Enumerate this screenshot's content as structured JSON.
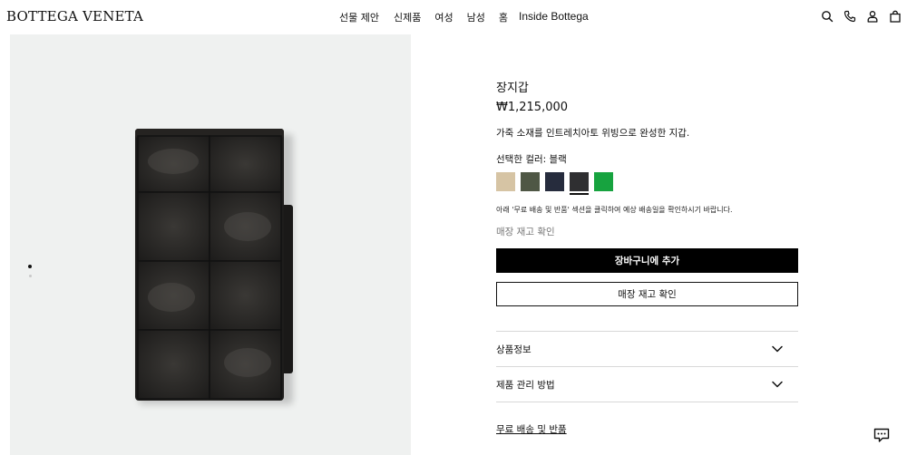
{
  "brand": {
    "logo": "BOTTEGA VENETA"
  },
  "nav": {
    "items": [
      {
        "label": "선물 제안"
      },
      {
        "label": "신제품"
      },
      {
        "label": "여성"
      },
      {
        "label": "남성"
      },
      {
        "label": "홈"
      },
      {
        "label": "Inside Bottega"
      }
    ]
  },
  "header_icons": [
    "search-icon",
    "phone-icon",
    "account-icon",
    "shopping-bag-icon"
  ],
  "gallery": {
    "image": "wallet-image",
    "slide_indicator": {
      "total": 2,
      "active": 1
    }
  },
  "product": {
    "title": "장지갑",
    "price": "₩1,215,000",
    "description": "가죽 소재를 인트레치아토 위빙으로 완성한 지갑.",
    "color_label": "선택한 컬러: 블랙",
    "swatches": [
      {
        "name": "beige",
        "color": "#d6c4a4"
      },
      {
        "name": "olive",
        "color": "#4f5745"
      },
      {
        "name": "navy",
        "color": "#262c3d"
      },
      {
        "name": "black",
        "color": "#2f2f31",
        "selected": true
      },
      {
        "name": "green",
        "color": "#17a33f"
      }
    ],
    "shipping_note": "아래 '무료 배송 및 반품' 섹션을 클릭하여 예상 배송일을 확인하시기 바랍니다.",
    "store_stock_link": "매장 재고 확인",
    "add_to_bag": "장바구니에 추가",
    "check_store_stock": "매장 재고 확인",
    "accordion": [
      {
        "label": "상품정보"
      },
      {
        "label": "제품 관리 방법"
      }
    ],
    "free_shipping_link": "무료 배송 및 반품"
  },
  "colors": {
    "gallery_bg": "#eff1f0",
    "primary_button": "#000000",
    "divider": "#d8d8d8"
  }
}
